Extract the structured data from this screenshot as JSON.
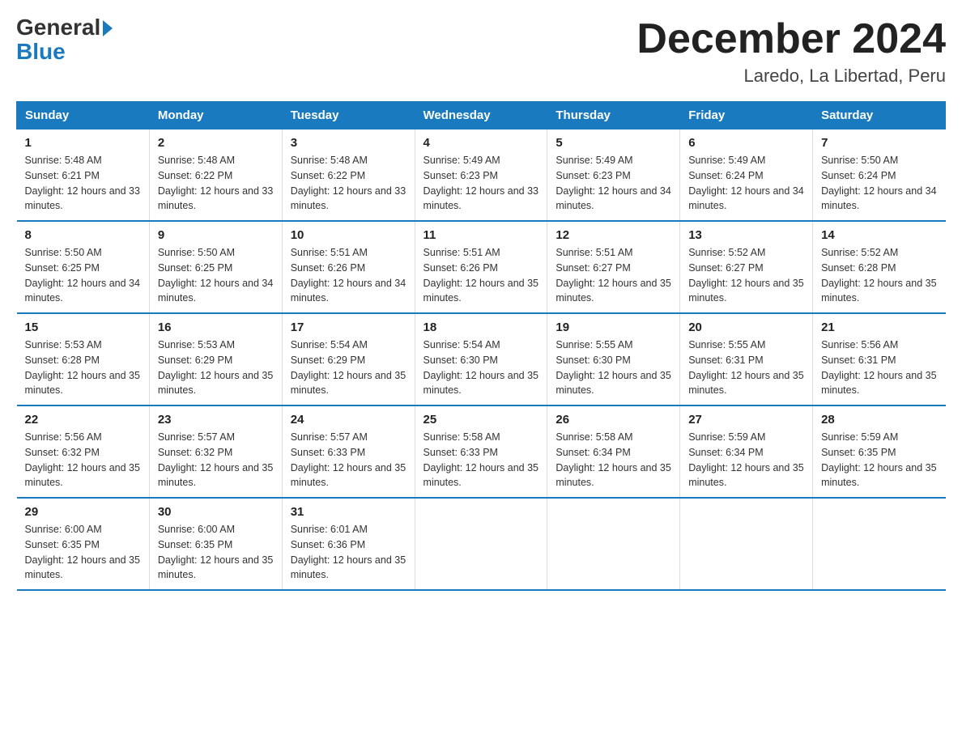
{
  "header": {
    "logo_general": "General",
    "logo_blue": "Blue",
    "title": "December 2024",
    "subtitle": "Laredo, La Libertad, Peru"
  },
  "days_of_week": [
    "Sunday",
    "Monday",
    "Tuesday",
    "Wednesday",
    "Thursday",
    "Friday",
    "Saturday"
  ],
  "weeks": [
    [
      {
        "day": "1",
        "sunrise": "Sunrise: 5:48 AM",
        "sunset": "Sunset: 6:21 PM",
        "daylight": "Daylight: 12 hours and 33 minutes."
      },
      {
        "day": "2",
        "sunrise": "Sunrise: 5:48 AM",
        "sunset": "Sunset: 6:22 PM",
        "daylight": "Daylight: 12 hours and 33 minutes."
      },
      {
        "day": "3",
        "sunrise": "Sunrise: 5:48 AM",
        "sunset": "Sunset: 6:22 PM",
        "daylight": "Daylight: 12 hours and 33 minutes."
      },
      {
        "day": "4",
        "sunrise": "Sunrise: 5:49 AM",
        "sunset": "Sunset: 6:23 PM",
        "daylight": "Daylight: 12 hours and 33 minutes."
      },
      {
        "day": "5",
        "sunrise": "Sunrise: 5:49 AM",
        "sunset": "Sunset: 6:23 PM",
        "daylight": "Daylight: 12 hours and 34 minutes."
      },
      {
        "day": "6",
        "sunrise": "Sunrise: 5:49 AM",
        "sunset": "Sunset: 6:24 PM",
        "daylight": "Daylight: 12 hours and 34 minutes."
      },
      {
        "day": "7",
        "sunrise": "Sunrise: 5:50 AM",
        "sunset": "Sunset: 6:24 PM",
        "daylight": "Daylight: 12 hours and 34 minutes."
      }
    ],
    [
      {
        "day": "8",
        "sunrise": "Sunrise: 5:50 AM",
        "sunset": "Sunset: 6:25 PM",
        "daylight": "Daylight: 12 hours and 34 minutes."
      },
      {
        "day": "9",
        "sunrise": "Sunrise: 5:50 AM",
        "sunset": "Sunset: 6:25 PM",
        "daylight": "Daylight: 12 hours and 34 minutes."
      },
      {
        "day": "10",
        "sunrise": "Sunrise: 5:51 AM",
        "sunset": "Sunset: 6:26 PM",
        "daylight": "Daylight: 12 hours and 34 minutes."
      },
      {
        "day": "11",
        "sunrise": "Sunrise: 5:51 AM",
        "sunset": "Sunset: 6:26 PM",
        "daylight": "Daylight: 12 hours and 35 minutes."
      },
      {
        "day": "12",
        "sunrise": "Sunrise: 5:51 AM",
        "sunset": "Sunset: 6:27 PM",
        "daylight": "Daylight: 12 hours and 35 minutes."
      },
      {
        "day": "13",
        "sunrise": "Sunrise: 5:52 AM",
        "sunset": "Sunset: 6:27 PM",
        "daylight": "Daylight: 12 hours and 35 minutes."
      },
      {
        "day": "14",
        "sunrise": "Sunrise: 5:52 AM",
        "sunset": "Sunset: 6:28 PM",
        "daylight": "Daylight: 12 hours and 35 minutes."
      }
    ],
    [
      {
        "day": "15",
        "sunrise": "Sunrise: 5:53 AM",
        "sunset": "Sunset: 6:28 PM",
        "daylight": "Daylight: 12 hours and 35 minutes."
      },
      {
        "day": "16",
        "sunrise": "Sunrise: 5:53 AM",
        "sunset": "Sunset: 6:29 PM",
        "daylight": "Daylight: 12 hours and 35 minutes."
      },
      {
        "day": "17",
        "sunrise": "Sunrise: 5:54 AM",
        "sunset": "Sunset: 6:29 PM",
        "daylight": "Daylight: 12 hours and 35 minutes."
      },
      {
        "day": "18",
        "sunrise": "Sunrise: 5:54 AM",
        "sunset": "Sunset: 6:30 PM",
        "daylight": "Daylight: 12 hours and 35 minutes."
      },
      {
        "day": "19",
        "sunrise": "Sunrise: 5:55 AM",
        "sunset": "Sunset: 6:30 PM",
        "daylight": "Daylight: 12 hours and 35 minutes."
      },
      {
        "day": "20",
        "sunrise": "Sunrise: 5:55 AM",
        "sunset": "Sunset: 6:31 PM",
        "daylight": "Daylight: 12 hours and 35 minutes."
      },
      {
        "day": "21",
        "sunrise": "Sunrise: 5:56 AM",
        "sunset": "Sunset: 6:31 PM",
        "daylight": "Daylight: 12 hours and 35 minutes."
      }
    ],
    [
      {
        "day": "22",
        "sunrise": "Sunrise: 5:56 AM",
        "sunset": "Sunset: 6:32 PM",
        "daylight": "Daylight: 12 hours and 35 minutes."
      },
      {
        "day": "23",
        "sunrise": "Sunrise: 5:57 AM",
        "sunset": "Sunset: 6:32 PM",
        "daylight": "Daylight: 12 hours and 35 minutes."
      },
      {
        "day": "24",
        "sunrise": "Sunrise: 5:57 AM",
        "sunset": "Sunset: 6:33 PM",
        "daylight": "Daylight: 12 hours and 35 minutes."
      },
      {
        "day": "25",
        "sunrise": "Sunrise: 5:58 AM",
        "sunset": "Sunset: 6:33 PM",
        "daylight": "Daylight: 12 hours and 35 minutes."
      },
      {
        "day": "26",
        "sunrise": "Sunrise: 5:58 AM",
        "sunset": "Sunset: 6:34 PM",
        "daylight": "Daylight: 12 hours and 35 minutes."
      },
      {
        "day": "27",
        "sunrise": "Sunrise: 5:59 AM",
        "sunset": "Sunset: 6:34 PM",
        "daylight": "Daylight: 12 hours and 35 minutes."
      },
      {
        "day": "28",
        "sunrise": "Sunrise: 5:59 AM",
        "sunset": "Sunset: 6:35 PM",
        "daylight": "Daylight: 12 hours and 35 minutes."
      }
    ],
    [
      {
        "day": "29",
        "sunrise": "Sunrise: 6:00 AM",
        "sunset": "Sunset: 6:35 PM",
        "daylight": "Daylight: 12 hours and 35 minutes."
      },
      {
        "day": "30",
        "sunrise": "Sunrise: 6:00 AM",
        "sunset": "Sunset: 6:35 PM",
        "daylight": "Daylight: 12 hours and 35 minutes."
      },
      {
        "day": "31",
        "sunrise": "Sunrise: 6:01 AM",
        "sunset": "Sunset: 6:36 PM",
        "daylight": "Daylight: 12 hours and 35 minutes."
      },
      {
        "day": "",
        "sunrise": "",
        "sunset": "",
        "daylight": ""
      },
      {
        "day": "",
        "sunrise": "",
        "sunset": "",
        "daylight": ""
      },
      {
        "day": "",
        "sunrise": "",
        "sunset": "",
        "daylight": ""
      },
      {
        "day": "",
        "sunrise": "",
        "sunset": "",
        "daylight": ""
      }
    ]
  ],
  "colors": {
    "header_bg": "#1a7abf",
    "accent": "#1a7abf"
  }
}
